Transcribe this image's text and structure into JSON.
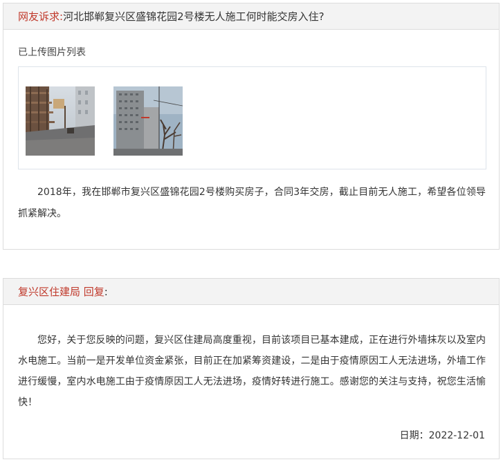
{
  "complaint": {
    "label": "网友诉求:",
    "title": "河北邯郸复兴区盛锦花园2号楼无人施工何时能交房入住?",
    "images_label": "已上传图片列表",
    "images": [
      {
        "icon": "construction-site-photo"
      },
      {
        "icon": "apartment-building-photo"
      }
    ],
    "body": "2018年，我在邯郸市复兴区盛锦花园2号楼购买房子，合同3年交房，截止目前无人施工，希望各位领导抓紧解决。"
  },
  "reply": {
    "department": "复兴区住建局 回复",
    "colon": ":",
    "body": "您好，关于您反映的问题，复兴区住建局高度重视，目前该项目已基本建成，正在进行外墙抹灰以及室内水电施工。当前一是开发单位资金紧张，目前正在加紧筹资建设，二是由于疫情原因工人无法进场，外墙工作进行缓慢，室内水电施工由于疫情原因工人无法进场，疫情好转进行施工。感谢您的关注与支持，祝您生活愉快！",
    "date_label": "日期：",
    "date_value": "2022-12-01"
  },
  "colors": {
    "accent_red": "#c0392b",
    "header_bg": "#f3f3f3",
    "border": "#dcdcdc"
  }
}
